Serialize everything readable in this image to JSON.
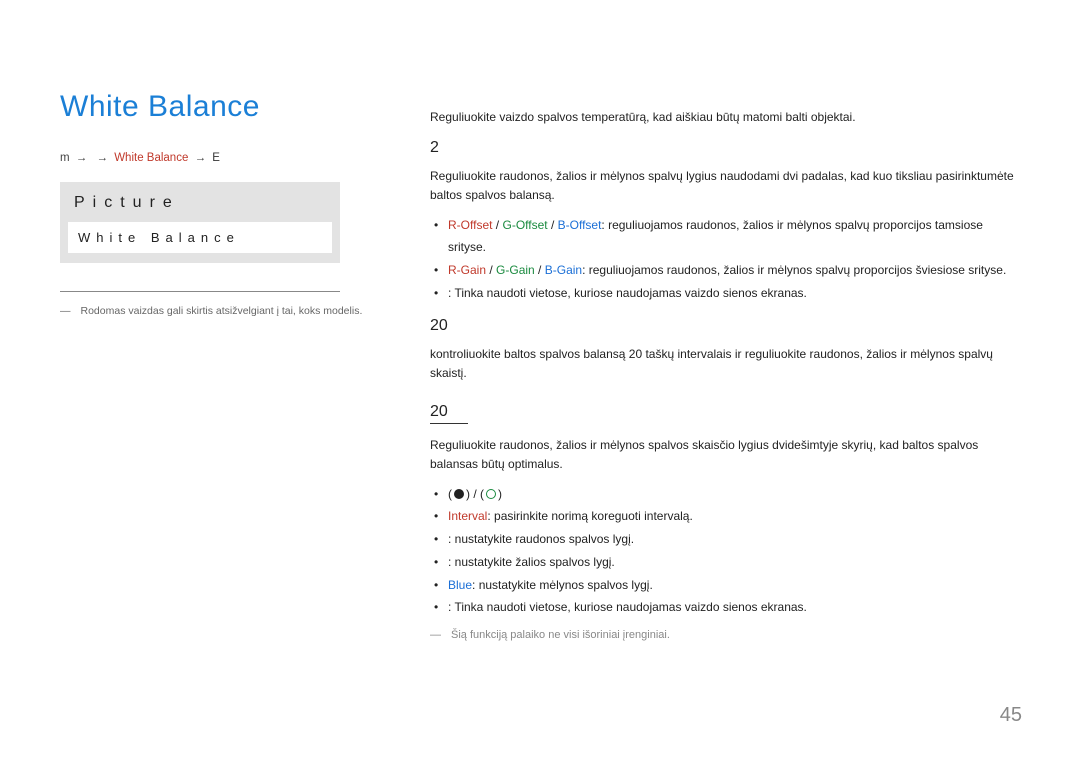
{
  "title": "White Balance",
  "breadcrumb": {
    "menu": "m",
    "path_hl": "White Balance",
    "suffix": "E"
  },
  "panel": {
    "title": "Picture",
    "item": "White Balance"
  },
  "footnote_left": "Rodomas vaizdas gali skirtis atsižvelgiant į tai, koks modelis.",
  "intro": "Reguliuokite vaizdo spalvos temperatūrą, kad aiškiau būtų matomi balti objektai.",
  "sec1": {
    "num": "2",
    "p": "Reguliuokite raudonos, žalios ir mėlynos spalvų lygius naudodami dvi padalas, kad kuo tiksliau pasirinktumėte baltos spalvos balansą.",
    "li1": {
      "r": "R-Offset",
      "g": "G-Offset",
      "b": "B-Offset",
      "tail": ": reguliuojamos raudonos, žalios ir mėlynos spalvų proporcijos tamsiose srityse."
    },
    "li2": {
      "r": "R-Gain",
      "g": "G-Gain",
      "b": "B-Gain",
      "tail": ": reguliuojamos raudonos, žalios ir mėlynos spalvų proporcijos šviesiose srityse."
    },
    "li3": ": Tinka naudoti vietose, kuriose naudojamas vaizdo sienos ekranas."
  },
  "sec2": {
    "num": "20",
    "p": "kontroliuokite baltos spalvos balansą 20 taškų intervalais ir reguliuokite raudonos, žalios ir mėlynos spalvų skaistį."
  },
  "sec3": {
    "num": "20",
    "p": "Reguliuokite raudonos, žalios ir mėlynos spalvos skaisčio lygius dvidešimtyje skyrių, kad baltos spalvos balansas būtų optimalus.",
    "li_toggle": {
      "open": "(",
      "mid": ") / (",
      "close": ")"
    },
    "li_interval": {
      "label": "Interval",
      "tail": ": pasirinkite norimą koreguoti intervalą."
    },
    "li_red": ": nustatykite raudonos spalvos lygį.",
    "li_green": ": nustatykite žalios spalvos lygį.",
    "li_blue": {
      "label": "Blue",
      "tail": ": nustatykite mėlynos spalvos lygį."
    },
    "li_wall": ": Tinka naudoti vietose, kuriose naudojamas vaizdo sienos ekranas.",
    "footnote": "Šią funkciją palaiko ne visi išoriniai įrenginiai."
  },
  "page_number": "45"
}
